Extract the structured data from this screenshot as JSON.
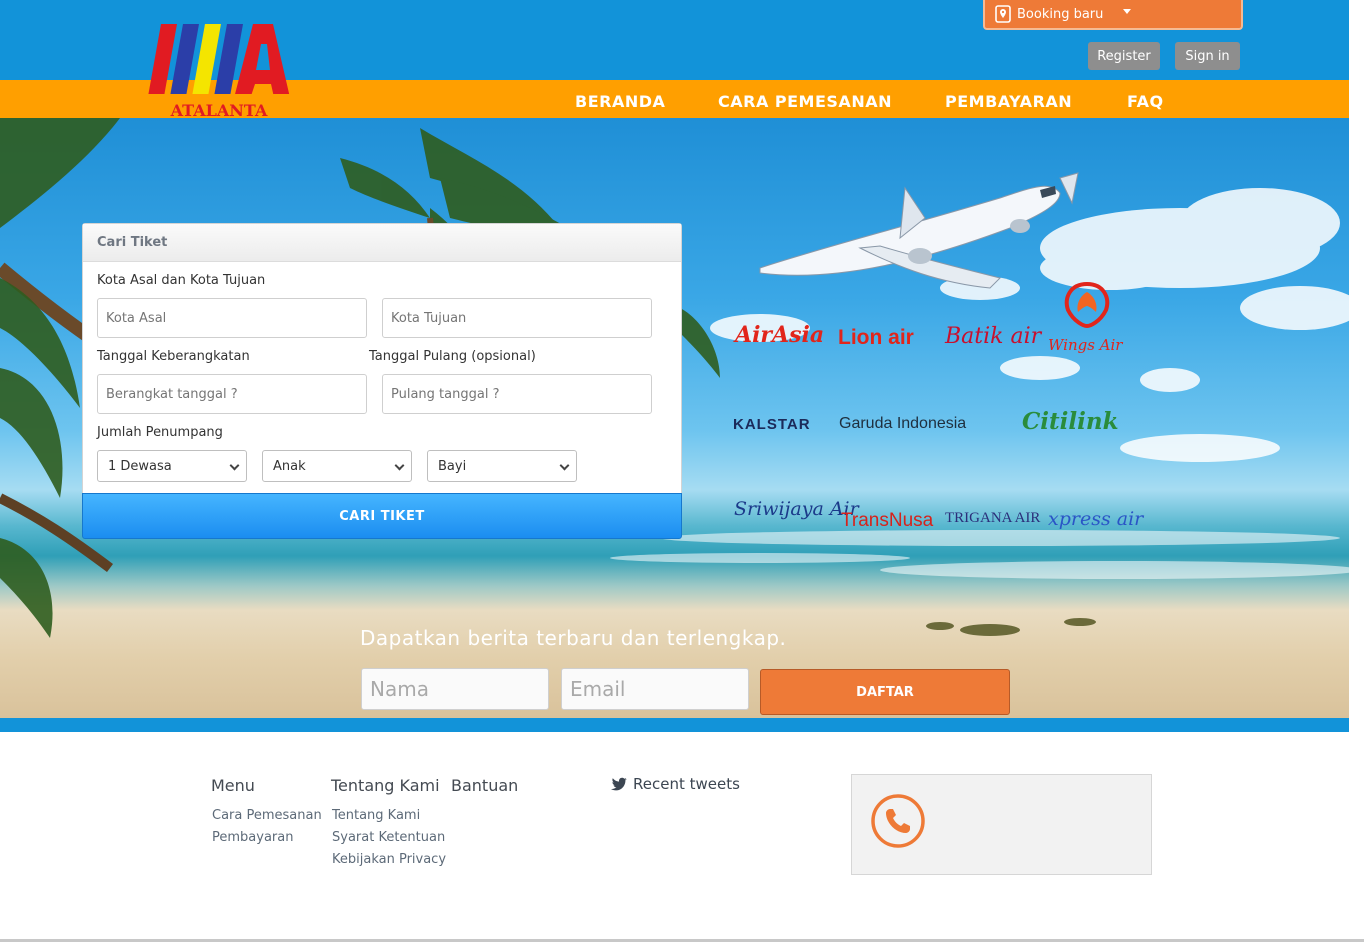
{
  "brand": {
    "name": "ATALANTA"
  },
  "header": {
    "booking_label": "Booking baru",
    "register_label": "Register",
    "signin_label": "Sign in"
  },
  "nav": {
    "items": [
      {
        "label": "BERANDA"
      },
      {
        "label": "CARA PEMESANAN"
      },
      {
        "label": "PEMBAYARAN"
      },
      {
        "label": "FAQ"
      }
    ]
  },
  "search": {
    "title": "Cari Tiket",
    "route_label": "Kota Asal dan Kota Tujuan",
    "origin_placeholder": "Kota Asal",
    "destination_placeholder": "Kota Tujuan",
    "depart_label": "Tanggal Keberangkatan",
    "return_label": "Tanggal Pulang (opsional)",
    "depart_placeholder": "Berangkat tanggal ?",
    "return_placeholder": "Pulang tanggal ?",
    "passenger_label": "Jumlah Penumpang",
    "adult_value": "1 Dewasa",
    "child_value": "Anak",
    "infant_value": "Bayi",
    "submit_label": "CARI TIKET"
  },
  "airlines": [
    {
      "name": "AirAsia",
      "color": "#e1251b"
    },
    {
      "name": "Lion air",
      "color": "#e1251b"
    },
    {
      "name": "Batik air",
      "color": "#c8102e"
    },
    {
      "name": "Wings Air",
      "color": "#e1251b"
    },
    {
      "name": "KALSTAR",
      "color": "#1b2a5a"
    },
    {
      "name": "Garuda Indonesia",
      "color": "#1e2f3e"
    },
    {
      "name": "Citilink",
      "color": "#2a8c3c"
    },
    {
      "name": "Sriwijaya Air",
      "color": "#1b3a8a"
    },
    {
      "name": "TransNusa",
      "color": "#d6231c"
    },
    {
      "name": "TRIGANA AIR",
      "color": "#2b2f7a"
    },
    {
      "name": "xpress air",
      "color": "#2a55c6"
    }
  ],
  "newsletter": {
    "title": "Dapatkan berita terbaru dan terlengkap.",
    "name_placeholder": "Nama",
    "email_placeholder": "Email",
    "submit_label": "DAFTAR"
  },
  "footer": {
    "menu": {
      "title": "Menu",
      "links": [
        "Cara Pemesanan",
        "Pembayaran"
      ]
    },
    "about": {
      "title": "Tentang Kami",
      "links": [
        "Tentang Kami",
        "Syarat Ketentuan",
        "Kebijakan Privacy"
      ]
    },
    "help": {
      "title": "Bantuan"
    },
    "tweets_label": "Recent tweets"
  },
  "colors": {
    "header_blue": "#1293d9",
    "nav_orange": "#ff9f00",
    "accent_orange": "#ee7a37",
    "search_button_blue": "#1b8df0"
  }
}
